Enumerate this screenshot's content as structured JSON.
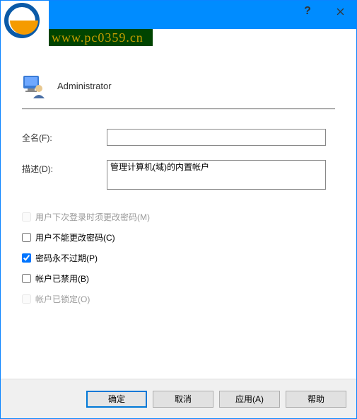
{
  "titlebar": {
    "help_tooltip": "?",
    "close_tooltip": "×"
  },
  "watermark_text": "www.pc0359.cn",
  "header": {
    "account_name": "Administrator"
  },
  "form": {
    "fullname_label": "全名(F):",
    "fullname_value": "",
    "description_label": "描述(D):",
    "description_value": "管理计算机(域)的内置帐户"
  },
  "checkboxes": {
    "must_change": {
      "label": "用户下次登录时须更改密码(M)",
      "checked": false,
      "disabled": true
    },
    "cannot_change": {
      "label": "用户不能更改密码(C)",
      "checked": false,
      "disabled": false
    },
    "never_expires": {
      "label": "密码永不过期(P)",
      "checked": true,
      "disabled": false
    },
    "disabled_acct": {
      "label": "帐户已禁用(B)",
      "checked": false,
      "disabled": false
    },
    "locked_out": {
      "label": "帐户已锁定(O)",
      "checked": false,
      "disabled": true
    }
  },
  "buttons": {
    "ok": "确定",
    "cancel": "取消",
    "apply": "应用(A)",
    "help": "帮助"
  }
}
